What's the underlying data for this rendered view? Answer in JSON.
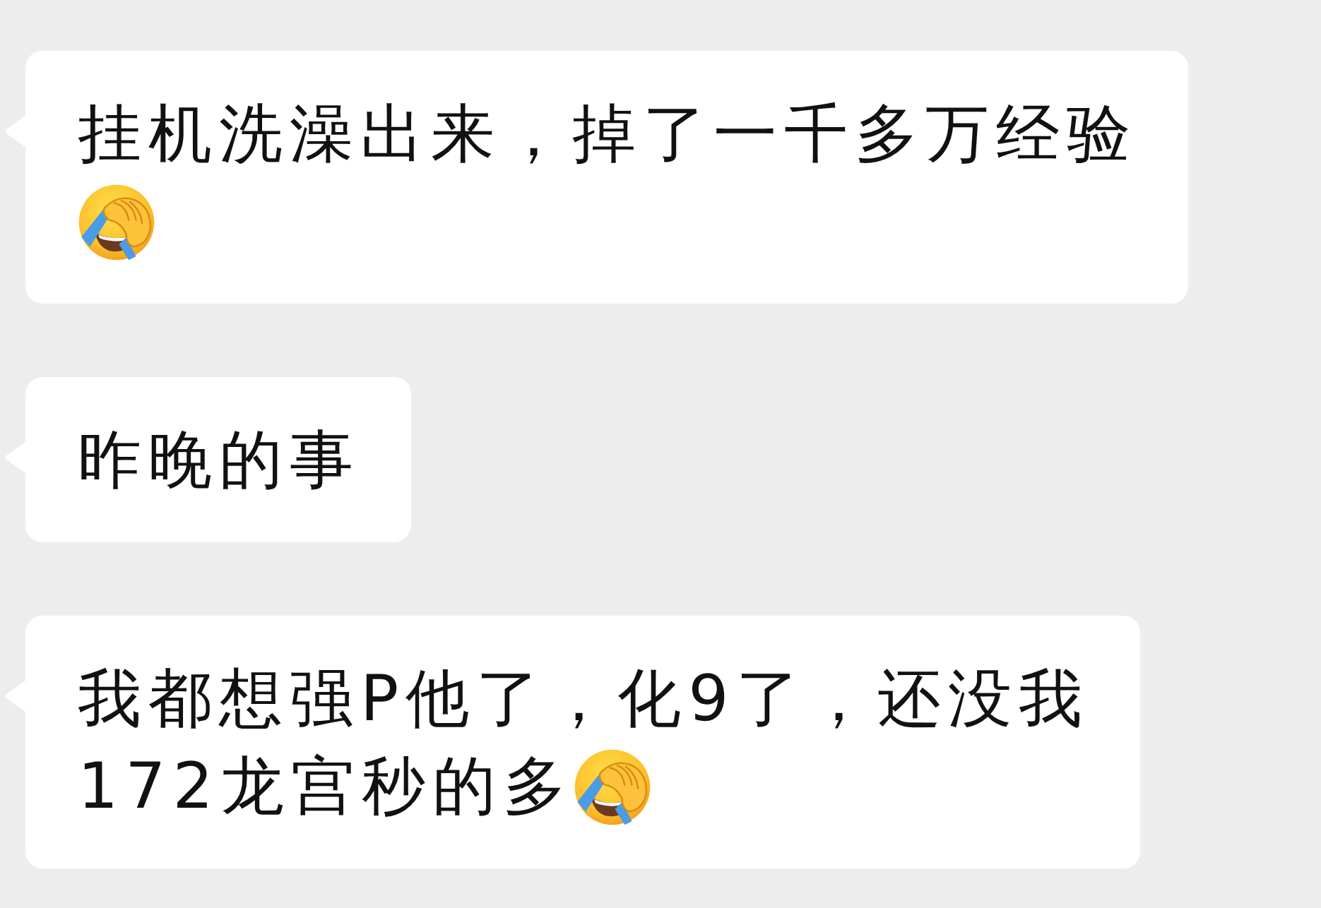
{
  "messages": [
    {
      "lines": [
        [
          {
            "kind": "text",
            "text": "挂机洗澡出来，掉了一千多万经验"
          }
        ],
        [
          {
            "kind": "emoji"
          }
        ]
      ]
    },
    {
      "lines": [
        [
          {
            "kind": "text",
            "text": "昨晚的事"
          }
        ]
      ]
    },
    {
      "lines": [
        [
          {
            "kind": "text",
            "text": "我都想强P他了，化9了，还没我"
          }
        ],
        [
          {
            "kind": "text",
            "text": "172龙宫秒的多"
          },
          {
            "kind": "emoji"
          }
        ]
      ]
    }
  ]
}
